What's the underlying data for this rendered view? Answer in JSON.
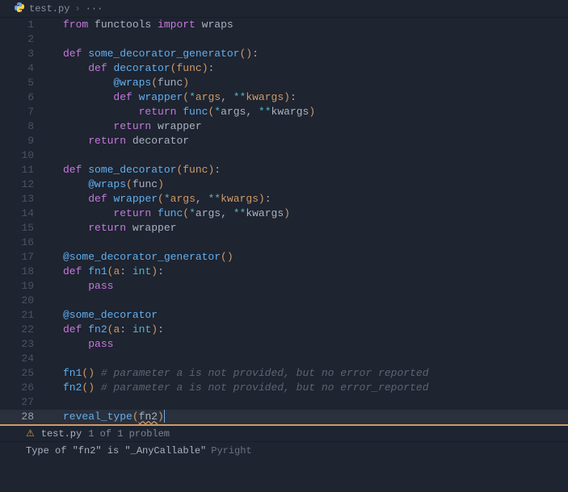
{
  "breadcrumb": {
    "file_icon": "⚙",
    "file_name": "test.py",
    "more": "···"
  },
  "lines": [
    {
      "n": 1,
      "tokens": [
        [
          "kw",
          "from"
        ],
        [
          "var",
          " functools "
        ],
        [
          "kw",
          "import"
        ],
        [
          "var",
          " wraps"
        ]
      ]
    },
    {
      "n": 2,
      "tokens": []
    },
    {
      "n": 3,
      "tokens": [
        [
          "kw",
          "def"
        ],
        [
          "var",
          " "
        ],
        [
          "fn",
          "some_decorator_generator"
        ],
        [
          "brkt",
          "()"
        ],
        [
          "punct",
          ":"
        ]
      ]
    },
    {
      "n": 4,
      "tokens": [
        [
          "var",
          "    "
        ],
        [
          "kw",
          "def"
        ],
        [
          "var",
          " "
        ],
        [
          "fn",
          "decorator"
        ],
        [
          "brkt",
          "("
        ],
        [
          "param",
          "func"
        ],
        [
          "brkt",
          ")"
        ],
        [
          "punct",
          ":"
        ]
      ]
    },
    {
      "n": 5,
      "tokens": [
        [
          "var",
          "        "
        ],
        [
          "dec",
          "@wraps"
        ],
        [
          "brkt",
          "("
        ],
        [
          "var",
          "func"
        ],
        [
          "brkt",
          ")"
        ]
      ]
    },
    {
      "n": 6,
      "tokens": [
        [
          "var",
          "        "
        ],
        [
          "kw",
          "def"
        ],
        [
          "var",
          " "
        ],
        [
          "fn",
          "wrapper"
        ],
        [
          "brkt",
          "("
        ],
        [
          "op",
          "*"
        ],
        [
          "param",
          "args"
        ],
        [
          "punct",
          ", "
        ],
        [
          "op",
          "**"
        ],
        [
          "param",
          "kwargs"
        ],
        [
          "brkt",
          ")"
        ],
        [
          "punct",
          ":"
        ]
      ]
    },
    {
      "n": 7,
      "tokens": [
        [
          "var",
          "            "
        ],
        [
          "kw",
          "return"
        ],
        [
          "var",
          " "
        ],
        [
          "fn",
          "func"
        ],
        [
          "brkt",
          "("
        ],
        [
          "op",
          "*"
        ],
        [
          "var",
          "args"
        ],
        [
          "punct",
          ", "
        ],
        [
          "op",
          "**"
        ],
        [
          "var",
          "kwargs"
        ],
        [
          "brkt",
          ")"
        ]
      ]
    },
    {
      "n": 8,
      "tokens": [
        [
          "var",
          "        "
        ],
        [
          "kw",
          "return"
        ],
        [
          "var",
          " wrapper"
        ]
      ]
    },
    {
      "n": 9,
      "tokens": [
        [
          "var",
          "    "
        ],
        [
          "kw",
          "return"
        ],
        [
          "var",
          " decorator"
        ]
      ]
    },
    {
      "n": 10,
      "tokens": []
    },
    {
      "n": 11,
      "tokens": [
        [
          "kw",
          "def"
        ],
        [
          "var",
          " "
        ],
        [
          "fn",
          "some_decorator"
        ],
        [
          "brkt",
          "("
        ],
        [
          "param",
          "func"
        ],
        [
          "brkt",
          ")"
        ],
        [
          "punct",
          ":"
        ]
      ]
    },
    {
      "n": 12,
      "tokens": [
        [
          "var",
          "    "
        ],
        [
          "dec",
          "@wraps"
        ],
        [
          "brkt",
          "("
        ],
        [
          "var",
          "func"
        ],
        [
          "brkt",
          ")"
        ]
      ]
    },
    {
      "n": 13,
      "tokens": [
        [
          "var",
          "    "
        ],
        [
          "kw",
          "def"
        ],
        [
          "var",
          " "
        ],
        [
          "fn",
          "wrapper"
        ],
        [
          "brkt",
          "("
        ],
        [
          "op",
          "*"
        ],
        [
          "param",
          "args"
        ],
        [
          "punct",
          ", "
        ],
        [
          "op",
          "**"
        ],
        [
          "param",
          "kwargs"
        ],
        [
          "brkt",
          ")"
        ],
        [
          "punct",
          ":"
        ]
      ]
    },
    {
      "n": 14,
      "tokens": [
        [
          "var",
          "        "
        ],
        [
          "kw",
          "return"
        ],
        [
          "var",
          " "
        ],
        [
          "fn",
          "func"
        ],
        [
          "brkt",
          "("
        ],
        [
          "op",
          "*"
        ],
        [
          "var",
          "args"
        ],
        [
          "punct",
          ", "
        ],
        [
          "op",
          "**"
        ],
        [
          "var",
          "kwargs"
        ],
        [
          "brkt",
          ")"
        ]
      ]
    },
    {
      "n": 15,
      "tokens": [
        [
          "var",
          "    "
        ],
        [
          "kw",
          "return"
        ],
        [
          "var",
          " wrapper"
        ]
      ]
    },
    {
      "n": 16,
      "tokens": []
    },
    {
      "n": 17,
      "tokens": [
        [
          "dec",
          "@some_decorator_generator"
        ],
        [
          "brkt",
          "()"
        ]
      ]
    },
    {
      "n": 18,
      "tokens": [
        [
          "kw",
          "def"
        ],
        [
          "var",
          " "
        ],
        [
          "fn",
          "fn1"
        ],
        [
          "brkt",
          "("
        ],
        [
          "param",
          "a"
        ],
        [
          "punct",
          ": "
        ],
        [
          "type",
          "int"
        ],
        [
          "brkt",
          ")"
        ],
        [
          "punct",
          ":"
        ]
      ]
    },
    {
      "n": 19,
      "tokens": [
        [
          "var",
          "    "
        ],
        [
          "kw",
          "pass"
        ]
      ]
    },
    {
      "n": 20,
      "tokens": []
    },
    {
      "n": 21,
      "tokens": [
        [
          "dec",
          "@some_decorator"
        ]
      ]
    },
    {
      "n": 22,
      "tokens": [
        [
          "kw",
          "def"
        ],
        [
          "var",
          " "
        ],
        [
          "fn",
          "fn2"
        ],
        [
          "brkt",
          "("
        ],
        [
          "param",
          "a"
        ],
        [
          "punct",
          ": "
        ],
        [
          "type",
          "int"
        ],
        [
          "brkt",
          ")"
        ],
        [
          "punct",
          ":"
        ]
      ]
    },
    {
      "n": 23,
      "tokens": [
        [
          "var",
          "    "
        ],
        [
          "kw",
          "pass"
        ]
      ]
    },
    {
      "n": 24,
      "tokens": []
    },
    {
      "n": 25,
      "tokens": [
        [
          "fn",
          "fn1"
        ],
        [
          "brkt",
          "()"
        ],
        [
          "var",
          " "
        ],
        [
          "cmt",
          "# parameter a is not provided, but no error reported"
        ]
      ]
    },
    {
      "n": 26,
      "tokens": [
        [
          "fn",
          "fn2"
        ],
        [
          "brkt",
          "()"
        ],
        [
          "var",
          " "
        ],
        [
          "cmt",
          "# parameter a is not provided, but no error_reported"
        ]
      ]
    },
    {
      "n": 27,
      "tokens": []
    },
    {
      "n": 28,
      "current": true,
      "tokens": [
        [
          "fn",
          "reveal_type"
        ],
        [
          "brkt",
          "("
        ],
        [
          "warn-underline var",
          "fn2"
        ],
        [
          "brkt",
          ")"
        ],
        [
          "cursor",
          ""
        ]
      ]
    }
  ],
  "problems": {
    "file": "test.py",
    "count_text": "1 of 1 problem"
  },
  "diagnostic": {
    "message": "Type of \"fn2\" is \"_AnyCallable\"",
    "source": "Pyright"
  }
}
